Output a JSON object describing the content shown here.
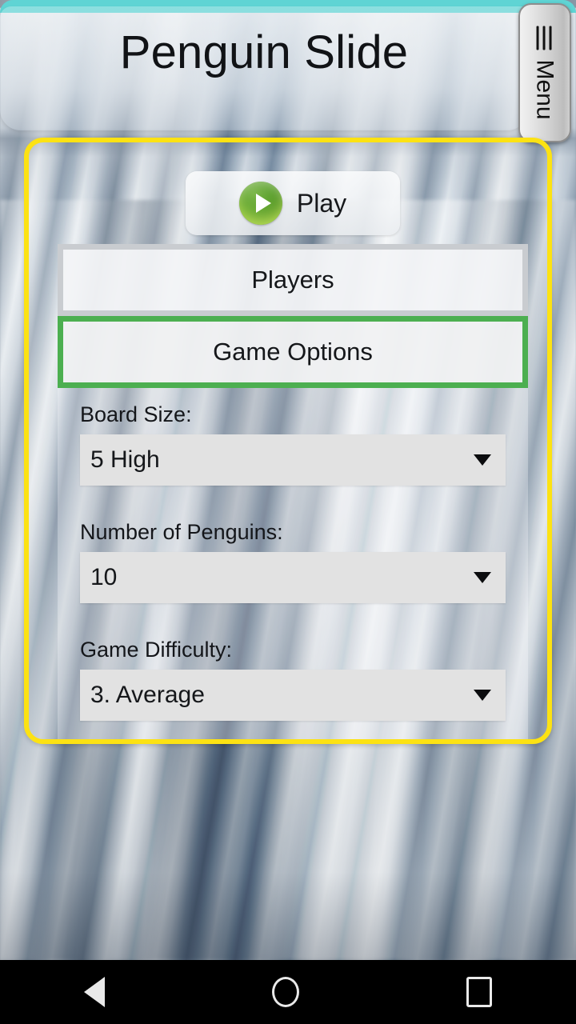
{
  "app": {
    "title": "Penguin Slide",
    "accent_yellow": "#FCE213",
    "accent_green": "#4CAF50",
    "top_strip_color": "#5FD4D4"
  },
  "menu_button": {
    "label": "Menu",
    "icon": "hamburger-icon"
  },
  "play_button": {
    "label": "Play",
    "icon": "play-circle-icon"
  },
  "tabs": [
    {
      "label": "Players",
      "selected": false
    },
    {
      "label": "Game Options",
      "selected": true
    }
  ],
  "options": [
    {
      "label": "Board Size:",
      "value": "5 High",
      "icon": "chevron-down-icon"
    },
    {
      "label": "Number of Penguins:",
      "value": "10",
      "icon": "chevron-down-icon"
    },
    {
      "label": "Game Difficulty:",
      "value": "3. Average",
      "icon": "chevron-down-icon"
    }
  ],
  "navbar": {
    "back": "back-triangle-icon",
    "home": "home-circle-icon",
    "recent": "recent-square-icon"
  }
}
